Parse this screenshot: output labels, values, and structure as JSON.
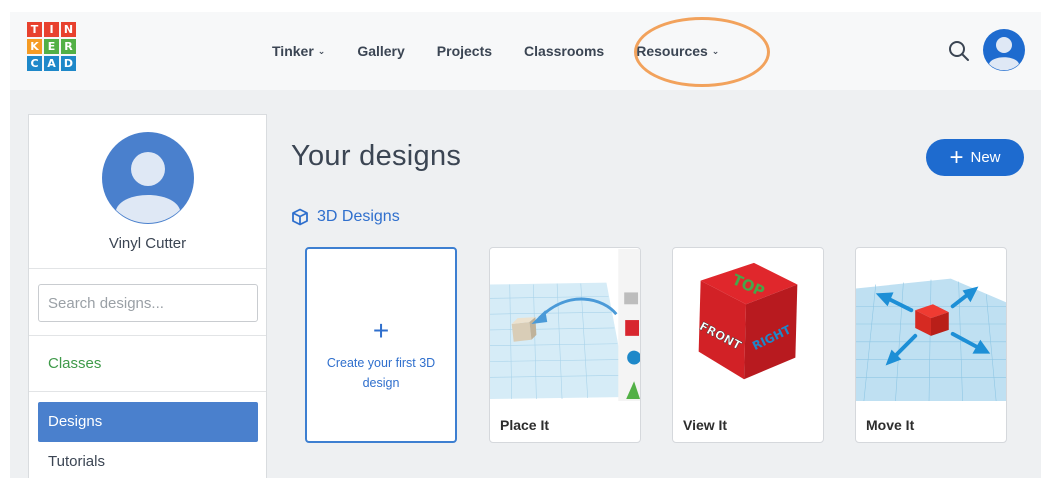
{
  "logo": {
    "letters": [
      "T",
      "I",
      "N",
      "K",
      "E",
      "R",
      "C",
      "A",
      "D"
    ]
  },
  "nav": {
    "tinker": "Tinker",
    "gallery": "Gallery",
    "projects": "Projects",
    "classrooms": "Classrooms",
    "resources": "Resources"
  },
  "sidebar": {
    "username": "Vinyl Cutter",
    "search_placeholder": "Search designs...",
    "classes": "Classes",
    "designs": "Designs",
    "tutorials": "Tutorials"
  },
  "main": {
    "title": "Your designs",
    "new_label": "New",
    "section_label": "3D Designs",
    "create_card": {
      "plus": "+",
      "text": "Create your first 3D design"
    },
    "cards": [
      {
        "label": "Place It"
      },
      {
        "label": "View It"
      },
      {
        "label": "Move It"
      }
    ],
    "cube_labels": {
      "top": "TOP",
      "front": "FRONT",
      "right": "RIGHT"
    }
  },
  "colors": {
    "accent": "#1e6bcf",
    "highlight": "#f2a25c",
    "classes": "#3f9a4a",
    "selected_item": "#4a80cd"
  }
}
